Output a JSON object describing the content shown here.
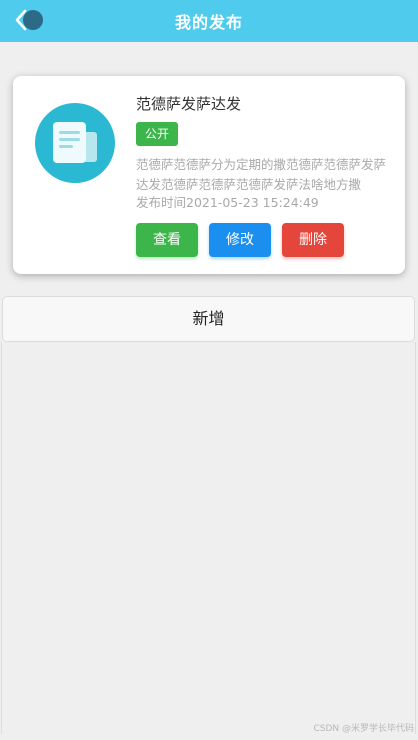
{
  "header": {
    "title": "我的发布",
    "back_icon": "chevron-left-icon"
  },
  "post": {
    "icon": "document-icon",
    "title": "范德萨发萨达发",
    "status": "公开",
    "description": "范德萨范德萨分为定期的撒范德萨范德萨发萨达发范德萨范德萨范德萨发萨法啥地方撒",
    "publish_time": "发布时间2021-05-23 15:24:49",
    "actions": {
      "view": "查看",
      "edit": "修改",
      "delete": "删除"
    }
  },
  "add_button": "新增",
  "watermark": "CSDN @米罗学长毕代码",
  "colors": {
    "header": "#4fcbee",
    "badge": "#3cb64a",
    "view": "#3cb64a",
    "edit": "#1b8fef",
    "delete": "#e5463c",
    "icon_circle": "#2ab8d3"
  }
}
